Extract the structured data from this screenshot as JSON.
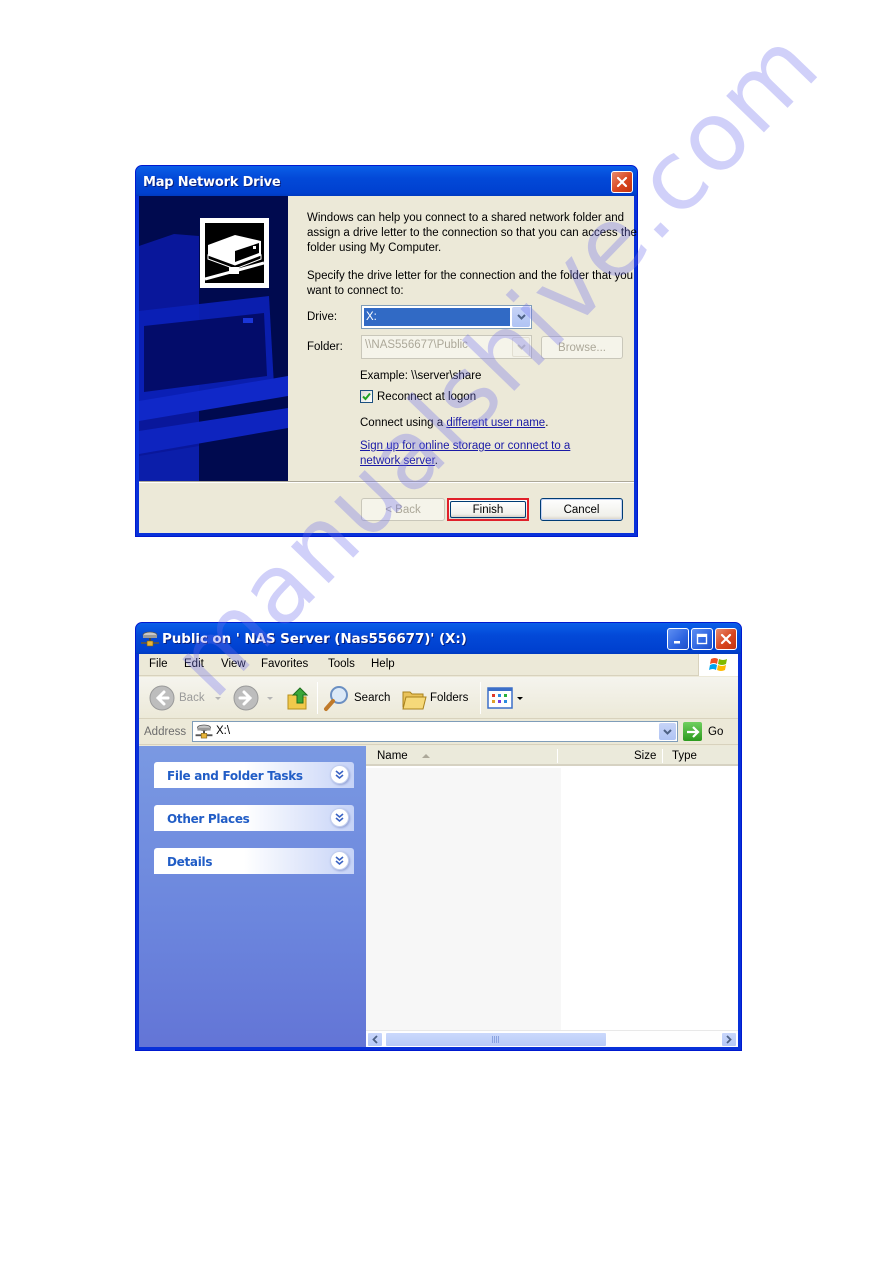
{
  "dialog": {
    "title": "Map Network Drive",
    "intro_text": "Windows can help you connect to a shared network folder and assign a drive letter to the connection so that you can access the folder using My Computer.",
    "instruction_text": "Specify the drive letter for the connection and the folder that you want to connect to:",
    "drive_label": "Drive:",
    "drive_value": "X:",
    "folder_label": "Folder:",
    "folder_value": "\\\\NAS556677\\Public",
    "browse_label": "Browse...",
    "example_text": "Example: \\\\server\\share",
    "reconnect_label": "Reconnect at logon",
    "reconnect_checked": true,
    "connect_using_prefix": "Connect using a ",
    "connect_using_link": "different user name",
    "connect_using_suffix": ".",
    "signup_link": "Sign up for online storage or connect to a network server",
    "signup_suffix": ".",
    "back_label": "< Back",
    "finish_label": "Finish",
    "cancel_label": "Cancel",
    "highlight_color": "#e0202a"
  },
  "explorer": {
    "title": "Public on ' NAS Server (Nas556677)' (X:)",
    "menu": [
      {
        "label": "File",
        "accel": "F"
      },
      {
        "label": "Edit",
        "accel": "E"
      },
      {
        "label": "View",
        "accel": "V"
      },
      {
        "label": "Favorites",
        "accel": "a"
      },
      {
        "label": "Tools",
        "accel": "T"
      },
      {
        "label": "Help",
        "accel": "H"
      }
    ],
    "menu_labels": [
      "File",
      "Edit",
      "View",
      "Favorites",
      "Tools",
      "Help"
    ],
    "toolbar": {
      "back_label": "Back",
      "search_label": "Search",
      "folders_label": "Folders"
    },
    "address_label": "Address",
    "address_value": "X:\\",
    "go_label": "Go",
    "task_pane": [
      {
        "label": "File and Folder Tasks"
      },
      {
        "label": "Other Places"
      },
      {
        "label": "Details"
      }
    ],
    "columns": [
      "Name",
      "Size",
      "Type"
    ],
    "items": []
  },
  "watermark": "manualshive.com"
}
